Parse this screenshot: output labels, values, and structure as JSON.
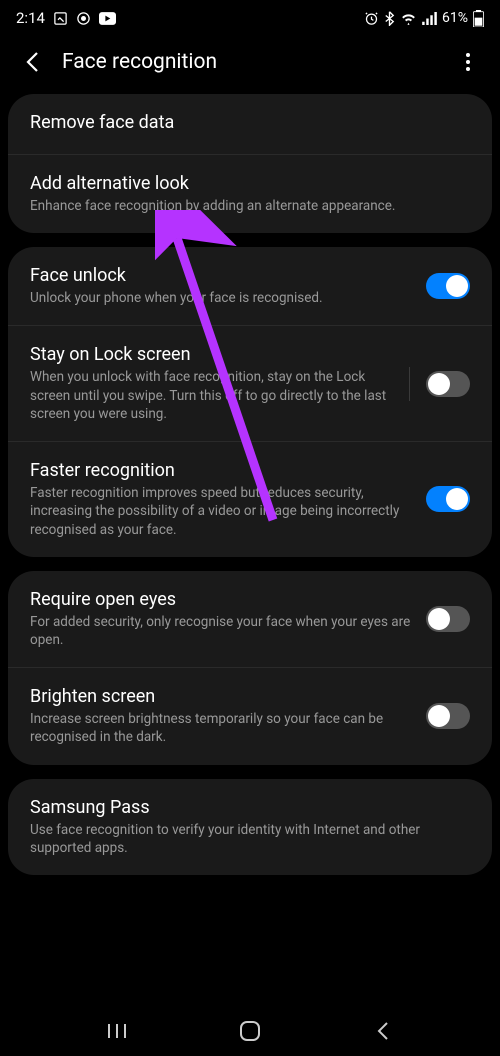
{
  "status_bar": {
    "time": "2:14",
    "battery_pct": "61%"
  },
  "app_bar": {
    "title": "Face recognition"
  },
  "groups": [
    {
      "items": [
        {
          "title": "Remove face data",
          "subtitle": null,
          "toggle": null
        },
        {
          "title": "Add alternative look",
          "subtitle": "Enhance face recognition by adding an alternate appearance.",
          "toggle": null
        }
      ]
    },
    {
      "items": [
        {
          "title": "Face unlock",
          "subtitle": "Unlock your phone when your face is recognised.",
          "toggle": true
        },
        {
          "title": "Stay on Lock screen",
          "subtitle": "When you unlock with face recognition, stay on the Lock screen until you swipe. Turn this off to go directly to the last screen you were using.",
          "toggle": false,
          "divider": true
        },
        {
          "title": "Faster recognition",
          "subtitle": "Faster recognition improves speed but reduces security, increasing the possibility of a video or image being incorrectly recognised as your face.",
          "toggle": true
        }
      ]
    },
    {
      "items": [
        {
          "title": "Require open eyes",
          "subtitle": "For added security, only recognise your face when your eyes are open.",
          "toggle": false
        },
        {
          "title": "Brighten screen",
          "subtitle": "Increase screen brightness temporarily so your face can be recognised in the dark.",
          "toggle": false
        }
      ]
    },
    {
      "items": [
        {
          "title": "Samsung Pass",
          "subtitle": "Use face recognition to verify your identity with Internet and other supported apps.",
          "toggle": null
        }
      ]
    }
  ]
}
